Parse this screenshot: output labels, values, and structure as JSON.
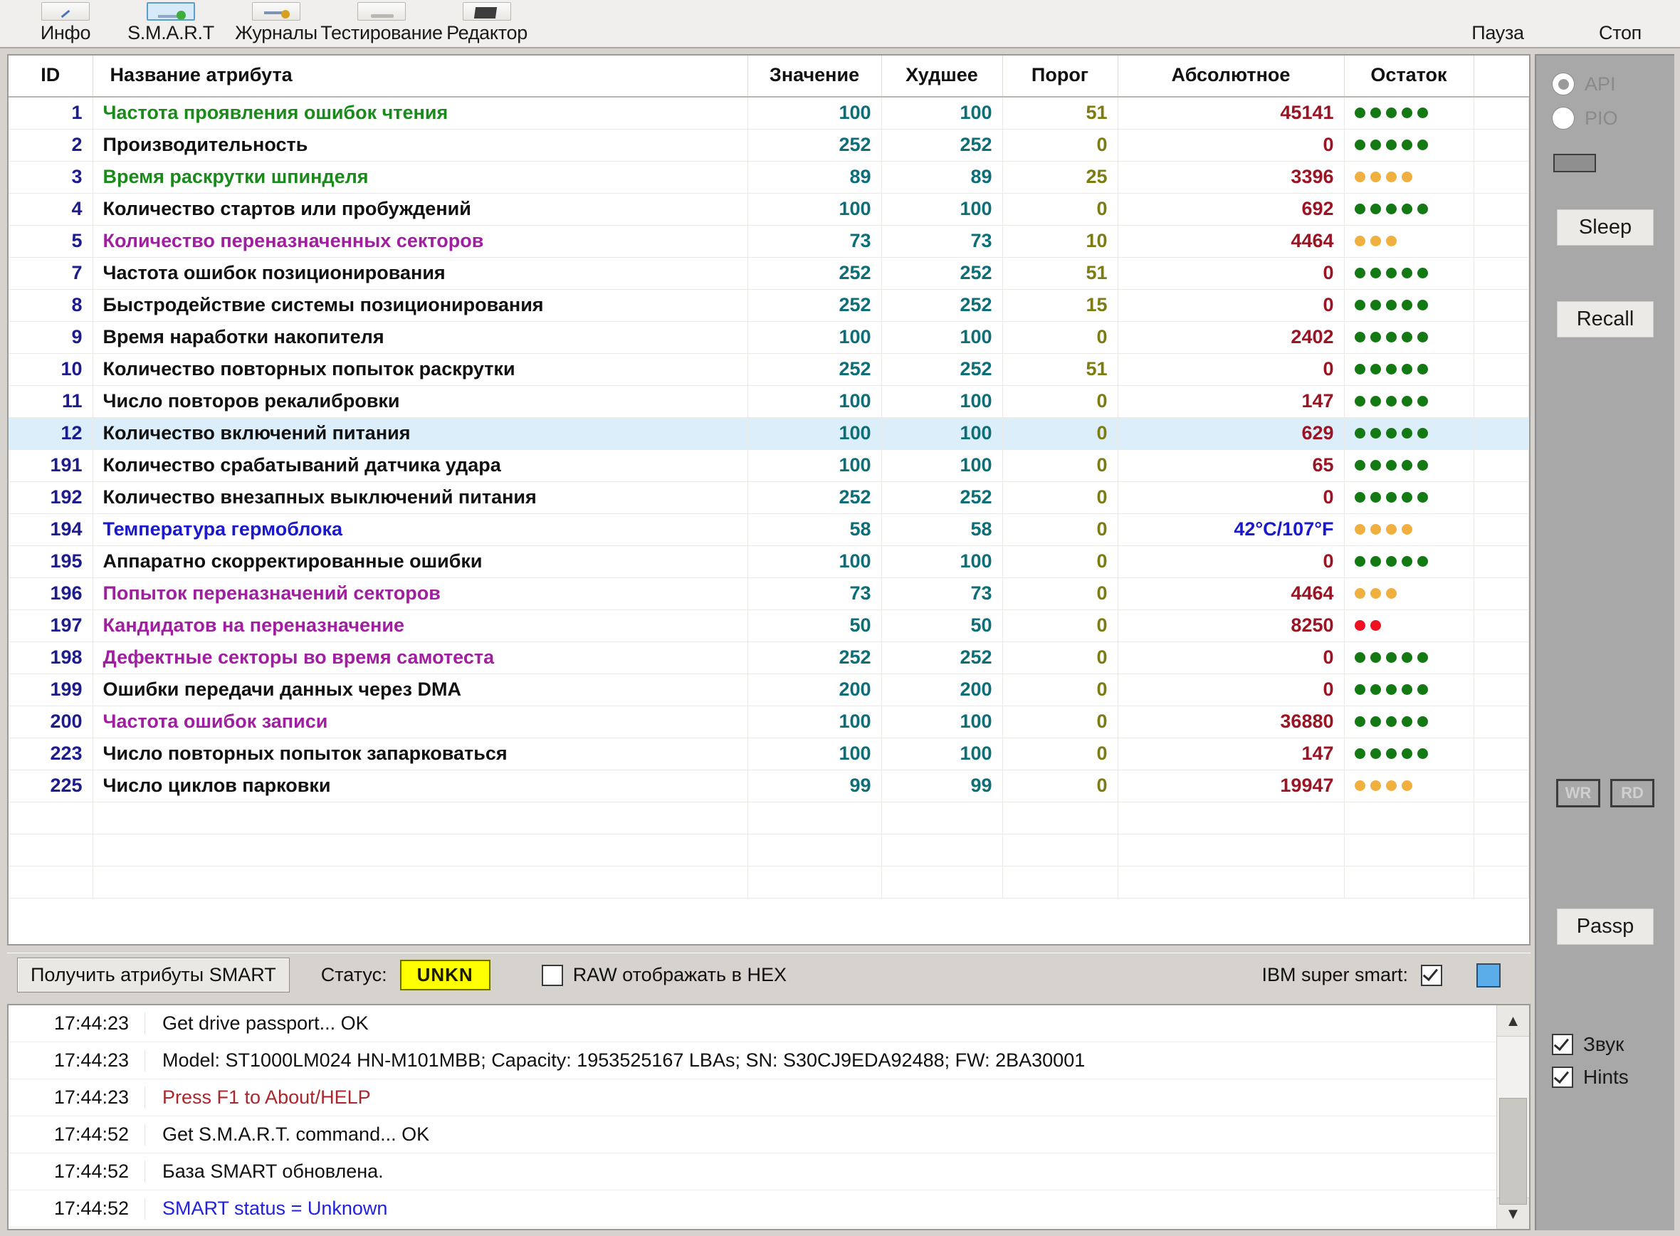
{
  "toolbar": {
    "items": [
      {
        "label": "Инфо",
        "icon": "arrow-icon",
        "active": false
      },
      {
        "label": "S.M.A.R.T",
        "icon": "disk-check-icon",
        "active": true
      },
      {
        "label": "Журналы",
        "icon": "journal-icon",
        "active": false
      },
      {
        "label": "Тестирование",
        "icon": "test-icon",
        "active": false
      },
      {
        "label": "Редактор",
        "icon": "editor-icon",
        "active": false
      }
    ],
    "right_items": [
      {
        "label": "Пауза",
        "icon": "pause-icon"
      },
      {
        "label": "Стоп",
        "icon": "stop-icon"
      }
    ]
  },
  "table": {
    "columns": [
      "ID",
      "Название атрибута",
      "Значение",
      "Худшее",
      "Порог",
      "Абсолютное",
      "Остаток"
    ],
    "filler_rows": 3,
    "rows": [
      {
        "id": "1",
        "name": "Частота проявления ошибок чтения",
        "name_color": "#1a8a1a",
        "value": "100",
        "worst": "100",
        "threshold": "51",
        "absolute": "45141",
        "dots": 5,
        "dot_color": "#137a13",
        "selected": false
      },
      {
        "id": "2",
        "name": "Производительность",
        "name_color": "#111111",
        "value": "252",
        "worst": "252",
        "threshold": "0",
        "absolute": "0",
        "dots": 5,
        "dot_color": "#137a13",
        "selected": false
      },
      {
        "id": "3",
        "name": "Время раскрутки шпинделя",
        "name_color": "#1a8a1a",
        "value": "89",
        "worst": "89",
        "threshold": "25",
        "absolute": "3396",
        "dots": 4,
        "dot_color": "#f0b040",
        "selected": false
      },
      {
        "id": "4",
        "name": "Количество стартов или пробуждений",
        "name_color": "#111111",
        "value": "100",
        "worst": "100",
        "threshold": "0",
        "absolute": "692",
        "dots": 5,
        "dot_color": "#137a13",
        "selected": false
      },
      {
        "id": "5",
        "name": "Количество переназначенных секторов",
        "name_color": "#a01fa0",
        "value": "73",
        "worst": "73",
        "threshold": "10",
        "absolute": "4464",
        "dots": 3,
        "dot_color": "#f0b040",
        "selected": false
      },
      {
        "id": "7",
        "name": "Частота ошибок позиционирования",
        "name_color": "#111111",
        "value": "252",
        "worst": "252",
        "threshold": "51",
        "absolute": "0",
        "dots": 5,
        "dot_color": "#137a13",
        "selected": false
      },
      {
        "id": "8",
        "name": "Быстродействие системы позиционирования",
        "name_color": "#111111",
        "value": "252",
        "worst": "252",
        "threshold": "15",
        "absolute": "0",
        "dots": 5,
        "dot_color": "#137a13",
        "selected": false
      },
      {
        "id": "9",
        "name": "Время наработки накопителя",
        "name_color": "#111111",
        "value": "100",
        "worst": "100",
        "threshold": "0",
        "absolute": "2402",
        "dots": 5,
        "dot_color": "#137a13",
        "selected": false
      },
      {
        "id": "10",
        "name": "Количество повторных попыток раскрутки",
        "name_color": "#111111",
        "value": "252",
        "worst": "252",
        "threshold": "51",
        "absolute": "0",
        "dots": 5,
        "dot_color": "#137a13",
        "selected": false
      },
      {
        "id": "11",
        "name": "Число повторов рекалибровки",
        "name_color": "#111111",
        "value": "100",
        "worst": "100",
        "threshold": "0",
        "absolute": "147",
        "dots": 5,
        "dot_color": "#137a13",
        "selected": false
      },
      {
        "id": "12",
        "name": "Количество включений питания",
        "name_color": "#111111",
        "value": "100",
        "worst": "100",
        "threshold": "0",
        "absolute": "629",
        "dots": 5,
        "dot_color": "#137a13",
        "selected": true
      },
      {
        "id": "191",
        "name": "Количество срабатываний датчика удара",
        "name_color": "#111111",
        "value": "100",
        "worst": "100",
        "threshold": "0",
        "absolute": "65",
        "dots": 5,
        "dot_color": "#137a13",
        "selected": false
      },
      {
        "id": "192",
        "name": "Количество внезапных выключений питания",
        "name_color": "#111111",
        "value": "252",
        "worst": "252",
        "threshold": "0",
        "absolute": "0",
        "dots": 5,
        "dot_color": "#137a13",
        "selected": false
      },
      {
        "id": "194",
        "name": "Температура гермоблока",
        "name_color": "#1a1acc",
        "value": "58",
        "worst": "58",
        "threshold": "0",
        "absolute": "42°C/107°F",
        "abs_color": "#1a1acc",
        "dots": 4,
        "dot_color": "#f0b040",
        "selected": false
      },
      {
        "id": "195",
        "name": "Аппаратно скорректированные ошибки",
        "name_color": "#111111",
        "value": "100",
        "worst": "100",
        "threshold": "0",
        "absolute": "0",
        "dots": 5,
        "dot_color": "#137a13",
        "selected": false
      },
      {
        "id": "196",
        "name": "Попыток переназначений секторов",
        "name_color": "#a01fa0",
        "value": "73",
        "worst": "73",
        "threshold": "0",
        "absolute": "4464",
        "dots": 3,
        "dot_color": "#f0b040",
        "selected": false
      },
      {
        "id": "197",
        "name": "Кандидатов на переназначение",
        "name_color": "#a01fa0",
        "value": "50",
        "worst": "50",
        "threshold": "0",
        "absolute": "8250",
        "dots": 2,
        "dot_color": "#ee1122",
        "selected": false
      },
      {
        "id": "198",
        "name": "Дефектные секторы во время самотеста",
        "name_color": "#a01fa0",
        "value": "252",
        "worst": "252",
        "threshold": "0",
        "absolute": "0",
        "dots": 5,
        "dot_color": "#137a13",
        "selected": false
      },
      {
        "id": "199",
        "name": "Ошибки передачи данных через DMA",
        "name_color": "#111111",
        "value": "200",
        "worst": "200",
        "threshold": "0",
        "absolute": "0",
        "dots": 5,
        "dot_color": "#137a13",
        "selected": false
      },
      {
        "id": "200",
        "name": "Частота ошибок записи",
        "name_color": "#a01fa0",
        "value": "100",
        "worst": "100",
        "threshold": "0",
        "absolute": "36880",
        "dots": 5,
        "dot_color": "#137a13",
        "selected": false
      },
      {
        "id": "223",
        "name": "Число повторных попыток запарковаться",
        "name_color": "#111111",
        "value": "100",
        "worst": "100",
        "threshold": "0",
        "absolute": "147",
        "dots": 5,
        "dot_color": "#137a13",
        "selected": false
      },
      {
        "id": "225",
        "name": "Число циклов парковки",
        "name_color": "#111111",
        "value": "99",
        "worst": "99",
        "threshold": "0",
        "absolute": "19947",
        "dots": 4,
        "dot_color": "#f0b040",
        "selected": false
      }
    ]
  },
  "statusbar": {
    "get_smart_label": "Получить атрибуты SMART",
    "status_label": "Статус:",
    "status_value": "UNKN",
    "status_bg": "#ffff00",
    "raw_hex_label": "RAW отображать в HEX",
    "raw_hex_checked": false,
    "ibm_label": "IBM super smart:",
    "ibm_checked": true,
    "swatch_color": "#5aade8"
  },
  "log": {
    "entries": [
      {
        "time": "17:44:23",
        "message": "Get drive passport... OK",
        "color": "#111111"
      },
      {
        "time": "17:44:23",
        "message": "Model: ST1000LM024 HN-M101MBB; Capacity: 1953525167 LBAs; SN: S30CJ9EDA92488; FW: 2BA30001",
        "color": "#111111"
      },
      {
        "time": "17:44:23",
        "message": "Press F1 to About/HELP",
        "color": "#a8282d"
      },
      {
        "time": "17:44:52",
        "message": "Get S.M.A.R.T. command... OK",
        "color": "#111111"
      },
      {
        "time": "17:44:52",
        "message": "База SMART обновлена.",
        "color": "#111111"
      },
      {
        "time": "17:44:52",
        "message": "SMART status = Unknown",
        "color": "#2222dd"
      }
    ],
    "scroll_up": "▲",
    "scroll_down": "▼"
  },
  "sidebar": {
    "mode_options": [
      {
        "label": "API",
        "selected": true
      },
      {
        "label": "PIO",
        "selected": false
      }
    ],
    "sleep_label": "Sleep",
    "recall_label": "Recall",
    "wr_label": "WR",
    "rd_label": "RD",
    "passp_label": "Passp",
    "sound_label": "Звук",
    "sound_checked": true,
    "hints_label": "Hints",
    "hints_checked": true
  }
}
